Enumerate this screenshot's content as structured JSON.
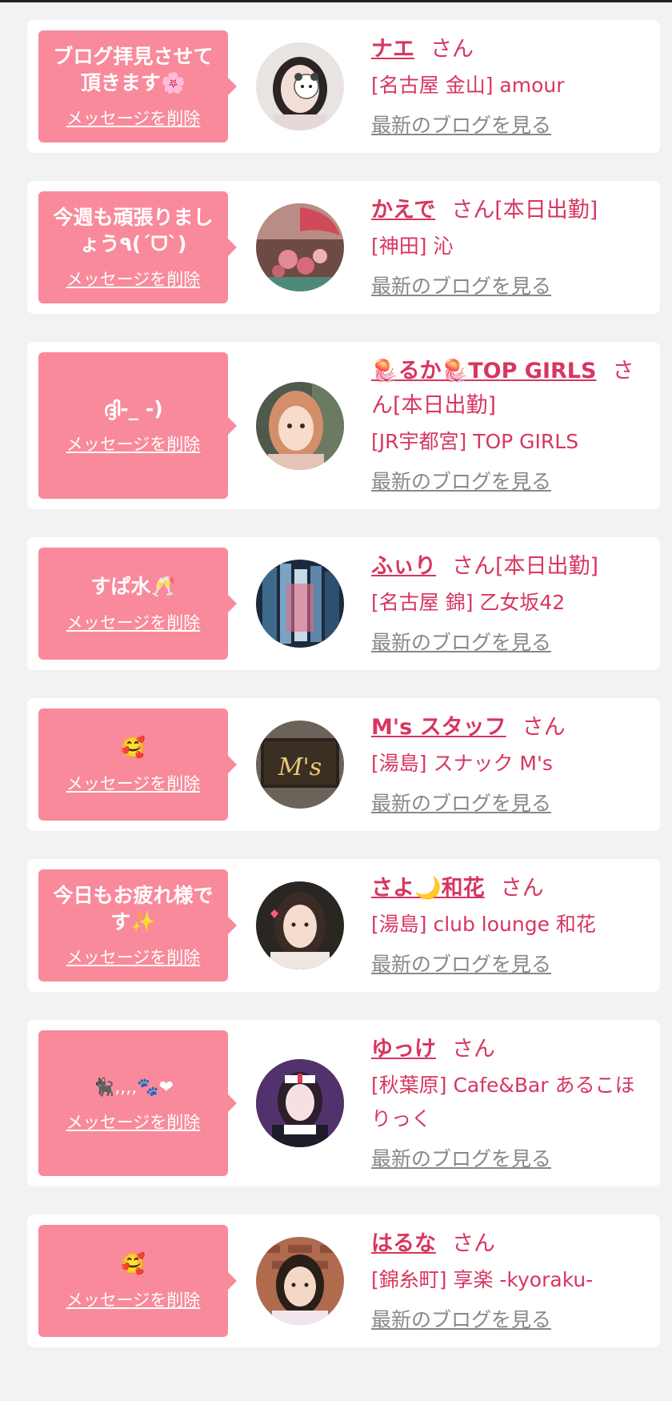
{
  "delete_label": "メッセージを削除",
  "blog_label": "最新のブログを見る",
  "san_label": "さん",
  "colors": {
    "page_background": "#f2f2f2",
    "card_background": "#ffffff",
    "bubble_pink": "#f88a9b",
    "accent_text": "#d8365f",
    "link_gray": "#888888"
  },
  "entries": [
    {
      "message": "ブログ拝見させて頂きます",
      "message_emoji": "🌸",
      "name": "ナエ",
      "status": "",
      "shop": "[名古屋 金山] amour",
      "avatar_icon": "woman-photo-with-panda-sticker"
    },
    {
      "message": "今週も頑張りましょう٩(ˊᗜˋ)",
      "message_emoji": "",
      "name": "かえで",
      "status": "[本日出勤]",
      "shop": "[神田] 沁",
      "avatar_icon": "rose-bouquet-photo"
    },
    {
      "message": "ദ്ദി-_ -)",
      "message_emoji": "",
      "name": "🪼るか🪼TOP GIRLS",
      "status": "[本日出勤]",
      "shop": "[JR宇都宮] TOP GIRLS",
      "avatar_icon": "woman-photo"
    },
    {
      "message": "すぱ水",
      "message_emoji": "🥂",
      "name": "ふぃり",
      "status": "[本日出勤]",
      "shop": "[名古屋 錦] 乙女坂42",
      "avatar_icon": "night-scene-photo"
    },
    {
      "message": "",
      "message_emoji": "🥰",
      "name": "M's スタッフ",
      "status": "",
      "shop": "[湯島] スナック M's",
      "avatar_icon": "snack-sign-photo"
    },
    {
      "message": "今日もお疲れ様です",
      "message_emoji": "✨",
      "name": "さよ🌙和花",
      "status": "",
      "shop": "[湯島] club lounge 和花",
      "avatar_icon": "woman-photo"
    },
    {
      "message": "",
      "message_emoji": "🐈‍⬛,,,,🐾❤",
      "name": "ゆっけ",
      "status": "",
      "shop": "[秋葉原] Cafe&Bar あるこほりっく",
      "avatar_icon": "cosplay-woman-photo"
    },
    {
      "message": "",
      "message_emoji": "🥰",
      "name": "はるな",
      "status": "",
      "shop": "[錦糸町] 享楽 -kyoraku-",
      "avatar_icon": "woman-photo"
    }
  ]
}
